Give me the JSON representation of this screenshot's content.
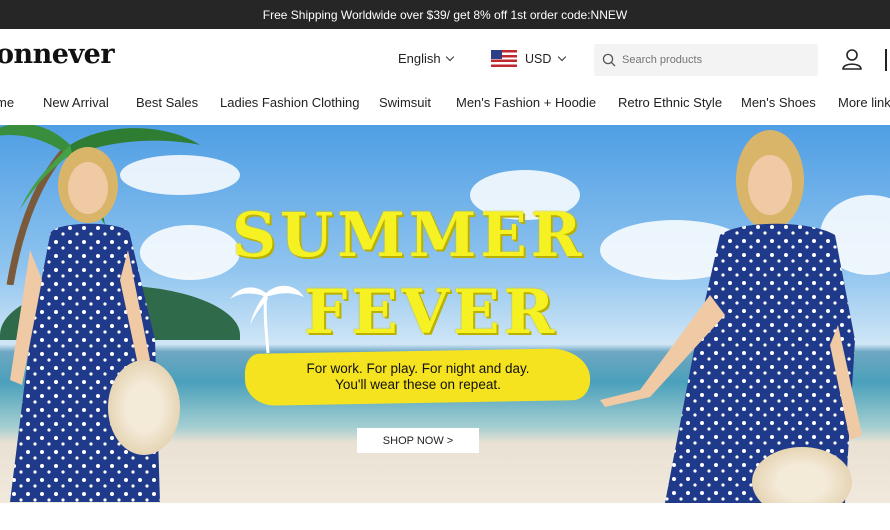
{
  "announcement": "Free Shipping Worldwide over $39/ get 8% off 1st order code:NNEW",
  "header": {
    "logo": "onnever",
    "language": "English",
    "currency": "USD",
    "search_placeholder": "Search products"
  },
  "nav": {
    "items": [
      "me",
      "New Arrival",
      "Best Sales",
      "Ladies Fashion Clothing",
      "Swimsuit",
      "Men's Fashion + Hoodie",
      "Retro Ethnic Style",
      "Men's Shoes",
      "More link"
    ]
  },
  "hero": {
    "title_line1": "SUMMER",
    "title_line2": "FEVER",
    "tagline_line1": "For work. For play. For night and day.",
    "tagline_line2": "You'll wear these on repeat.",
    "cta": "SHOP NOW >"
  },
  "colors": {
    "topbar": "#262626",
    "title_yellow": "#f6f123",
    "dress_blue": "#1f3a8a"
  }
}
